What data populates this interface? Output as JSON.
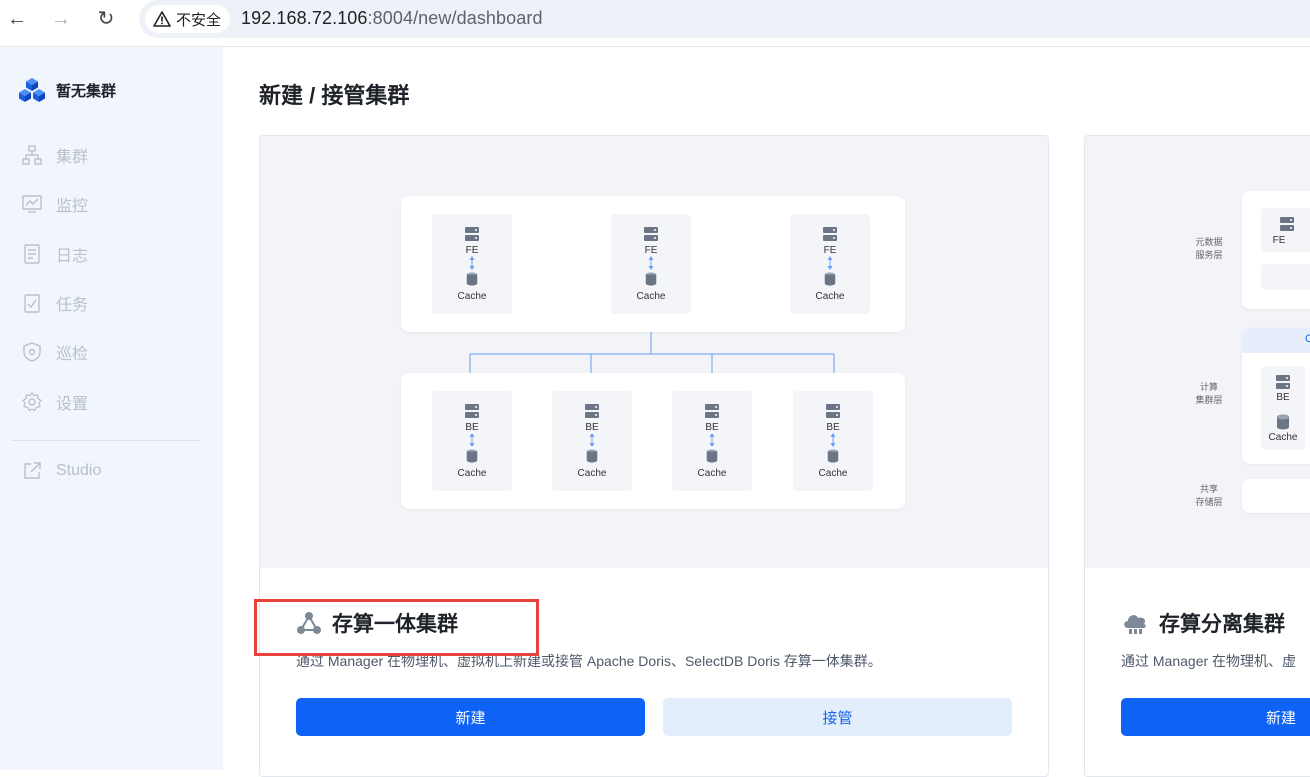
{
  "browser": {
    "security_label": "不安全",
    "url_host": "192.168.72.106",
    "url_rest": ":8004/new/dashboard"
  },
  "sidebar": {
    "brand": "暂无集群",
    "items": [
      {
        "label": "集群",
        "icon": "cluster-icon"
      },
      {
        "label": "监控",
        "icon": "monitor-icon"
      },
      {
        "label": "日志",
        "icon": "log-icon"
      },
      {
        "label": "任务",
        "icon": "task-icon"
      },
      {
        "label": "巡检",
        "icon": "shield-icon"
      },
      {
        "label": "设置",
        "icon": "gear-icon"
      }
    ],
    "studio": "Studio"
  },
  "main": {
    "title": "新建 / 接管集群",
    "cards": [
      {
        "title": "存算一体集群",
        "desc": "通过 Manager 在物理机、虚拟机上新建或接管 Apache Doris、SelectDB Doris 存算一体集群。",
        "btn_new": "新建",
        "btn_takeover": "接管",
        "diagram": {
          "fe": "FE",
          "be": "BE",
          "cache": "Cache"
        }
      },
      {
        "title": "存算分离集群",
        "desc": "通过 Manager 在物理机、虚",
        "btn_new": "新建",
        "diagram": {
          "layer_meta_1": "元数据",
          "layer_meta_2": "服务层",
          "layer_compute_1": "计算",
          "layer_compute_2": "集群层",
          "layer_storage_1": "共享",
          "layer_storage_2": "存储层",
          "fe": "FE",
          "be": "BE",
          "cache": "Cache",
          "cut_label": "C"
        }
      }
    ]
  },
  "colors": {
    "primary": "#0e62f5",
    "sidebar_bg": "#f1f6fd",
    "highlight": "#e8403c"
  }
}
